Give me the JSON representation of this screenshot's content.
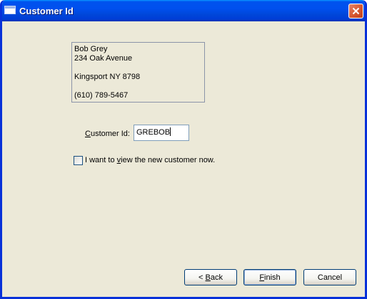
{
  "window": {
    "title": "Customer Id"
  },
  "address": {
    "lines": [
      "Bob Grey",
      "234 Oak Avenue",
      "",
      "Kingsport NY  8798",
      "",
      "(610) 789-5467"
    ]
  },
  "customer_id": {
    "label_pre": "",
    "label_key": "C",
    "label_post": "ustomer Id:",
    "value": "GREBOB"
  },
  "view_now": {
    "label_pre": "I want to ",
    "label_key": "v",
    "label_post": "iew the new customer now.",
    "checked": false
  },
  "buttons": {
    "back": {
      "pre": "< ",
      "key": "B",
      "post": "ack"
    },
    "finish": {
      "pre": "",
      "key": "F",
      "post": "inish"
    },
    "cancel": {
      "label": "Cancel"
    }
  },
  "colors": {
    "title_bar": "#0050ee",
    "face": "#ece9d8",
    "close": "#d85b34"
  }
}
